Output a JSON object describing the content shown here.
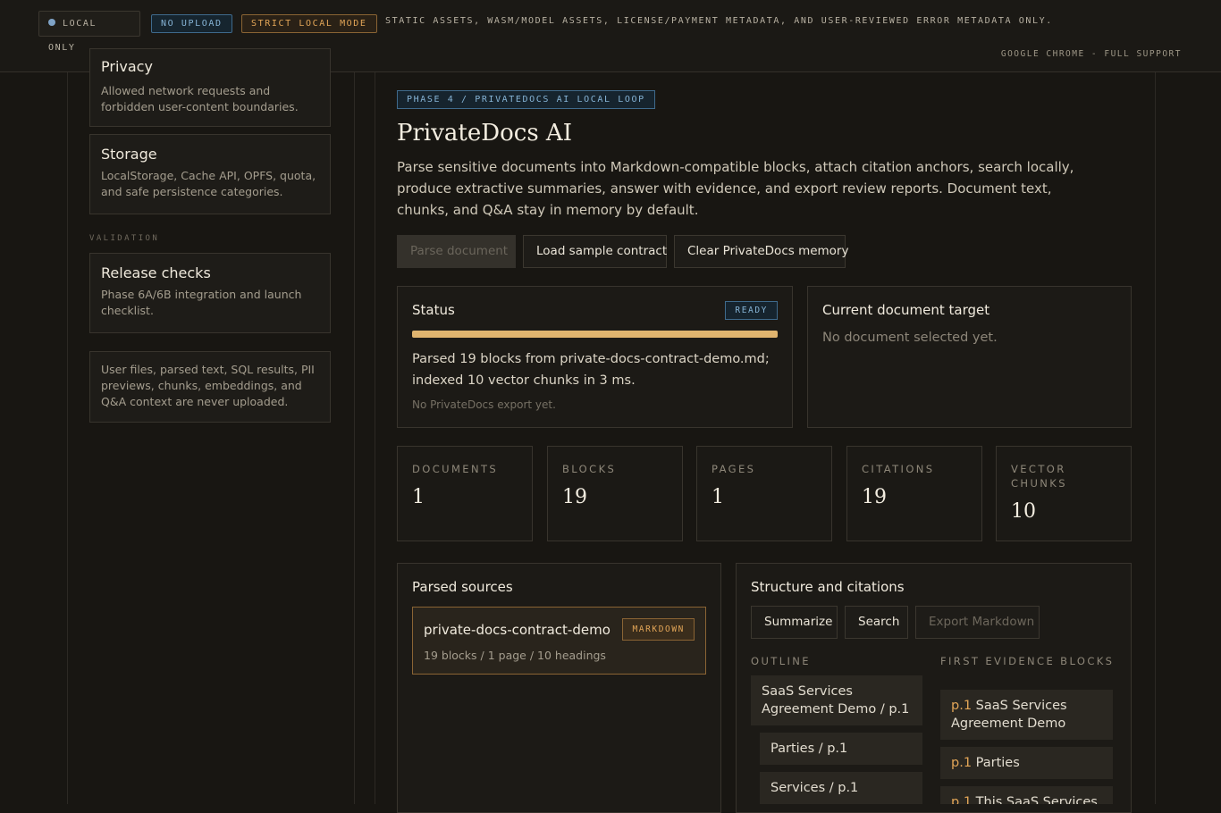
{
  "topbar": {
    "local_only": "LOCAL ONLY",
    "no_upload": "NO UPLOAD",
    "strict_mode": "STRICT LOCAL MODE",
    "description": "STATIC ASSETS, WASM/MODEL ASSETS, LICENSE/PAYMENT METADATA, AND USER-REVIEWED ERROR METADATA ONLY.",
    "browser_support": "GOOGLE CHROME - FULL SUPPORT"
  },
  "sidebar": {
    "privacy": {
      "title": "Privacy",
      "desc": "Allowed network requests and forbidden user-content boundaries."
    },
    "storage": {
      "title": "Storage",
      "desc": "LocalStorage, Cache API, OPFS, quota, and safe persistence categories."
    },
    "validation_label": "VALIDATION",
    "release": {
      "title": "Release checks",
      "desc": "Phase 6A/6B integration and launch checklist."
    },
    "notice": "User files, parsed text, SQL results, PII previews, chunks, embeddings, and Q&A context are never uploaded."
  },
  "main": {
    "phase_badge": "PHASE 4 / PRIVATEDOCS AI LOCAL LOOP",
    "title": "PrivateDocs AI",
    "lead": "Parse sensitive documents into Markdown-compatible blocks, attach citation anchors, search locally, produce extractive summaries, answer with evidence, and export review reports. Document text, chunks, and Q&A stay in memory by default.",
    "buttons": {
      "parse": "Parse document",
      "load_sample": "Load sample contract",
      "clear": "Clear PrivateDocs memory"
    },
    "status": {
      "title": "Status",
      "badge": "READY",
      "progress": 1.0,
      "text": "Parsed 19 blocks from private-docs-contract-demo.md; indexed 10 vector chunks in 3 ms.",
      "sub": "No PrivateDocs export yet."
    },
    "target": {
      "title": "Current document target",
      "text": "No document selected yet."
    },
    "stats": [
      {
        "label": "DOCUMENTS",
        "value": "1"
      },
      {
        "label": "BLOCKS",
        "value": "19"
      },
      {
        "label": "PAGES",
        "value": "1"
      },
      {
        "label": "CITATIONS",
        "value": "19"
      },
      {
        "label": "VECTOR CHUNKS",
        "value": "10"
      }
    ],
    "sources": {
      "title": "Parsed sources",
      "item": {
        "name": "private-docs-contract-demo",
        "badge": "MARKDOWN",
        "meta": "19 blocks / 1 page / 10 headings"
      }
    },
    "structure": {
      "title": "Structure and citations",
      "buttons": {
        "summarize": "Summarize",
        "search": "Search",
        "export": "Export Markdown"
      },
      "outline_label": "OUTLINE",
      "outline": [
        "SaaS Services Agreement Demo / p.1",
        "Parties / p.1",
        "Services / p.1"
      ],
      "evidence_label": "FIRST EVIDENCE BLOCKS",
      "evidence": [
        {
          "page": "p.1",
          "text": "SaaS Services Agreement Demo"
        },
        {
          "page": "p.1",
          "text": "Parties"
        },
        {
          "page": "p.1",
          "text": "This SaaS Services"
        }
      ]
    }
  }
}
